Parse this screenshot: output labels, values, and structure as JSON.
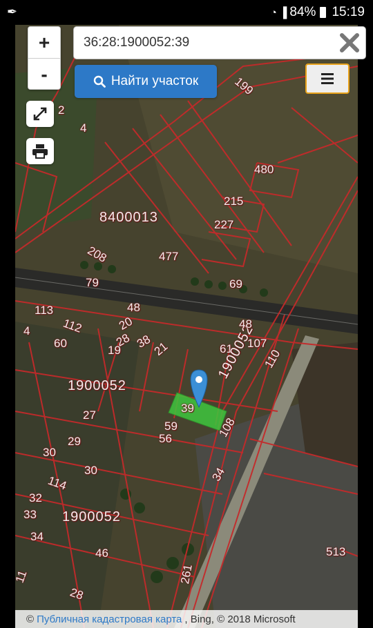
{
  "statusbar": {
    "notification_icon": "gift-icon",
    "wifi_icon": "wifi-icon",
    "signal_icon": "signal-icon",
    "battery": "84%",
    "time": "15:19"
  },
  "search": {
    "value": "36:28:1900052:39",
    "clear_icon": "close-icon",
    "find_label": "Найти участок",
    "find_icon": "search-icon"
  },
  "controls": {
    "zoom_in": "+",
    "zoom_out": "-",
    "fullscreen_icon": "expand-icon",
    "print_icon": "printer-icon",
    "menu_icon": "hamburger-menu-icon"
  },
  "map": {
    "selected_parcel": "39",
    "parcel_fill": "#3ec63e",
    "boundary_color": "#c42a2a",
    "marker_color": "#3b8fd6",
    "labels": [
      "199",
      "2",
      "4",
      "480",
      "215",
      "227",
      "8400013",
      "208",
      "477",
      "79",
      "69",
      "113",
      "4",
      "112",
      "60",
      "48",
      "20",
      "28",
      "38",
      "21",
      "61",
      "107",
      "19",
      "1900052",
      "110",
      "1900052",
      "39",
      "27",
      "59",
      "56",
      "29",
      "108",
      "30",
      "30",
      "114",
      "34",
      "32",
      "33",
      "34",
      "1900052",
      "46",
      "513",
      "261",
      "11",
      "28",
      "48"
    ]
  },
  "attribution": {
    "prefix": "©",
    "link": "Публичная кадастровая карта",
    "suffix": ", Bing, © 2018 Microsoft"
  }
}
